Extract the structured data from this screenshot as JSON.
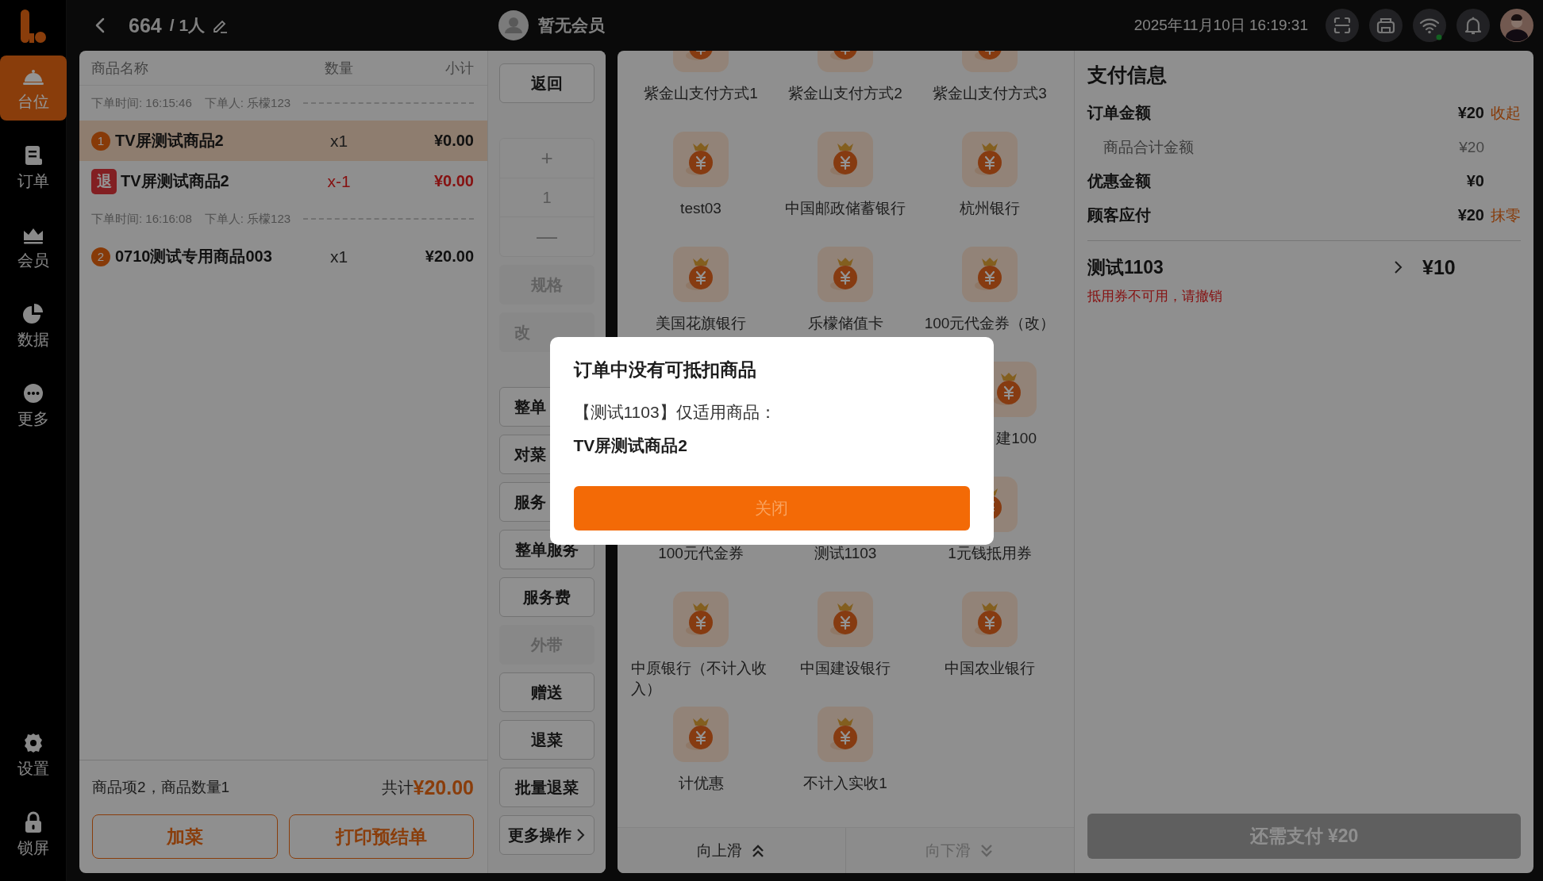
{
  "sidebar": {
    "items": [
      {
        "kind": "cloche",
        "label": "台位",
        "selected": true
      },
      {
        "kind": "document",
        "label": "订单",
        "selected": false
      },
      {
        "kind": "crown",
        "label": "会员",
        "selected": false
      },
      {
        "kind": "pie",
        "label": "数据",
        "selected": false
      },
      {
        "kind": "more",
        "label": "更多",
        "selected": false
      }
    ],
    "bottom_items": [
      {
        "kind": "gear",
        "label": "设置"
      },
      {
        "kind": "lock",
        "label": "锁屏"
      }
    ]
  },
  "top_bar": {
    "table": "664",
    "guests": "/ 1人",
    "member": "暂无会员",
    "datetime": "2025年11月10日 16:19:31"
  },
  "order_list": {
    "columns": [
      "商品名称",
      "数量",
      "小计"
    ],
    "groups": [
      {
        "time": "下单时间: 16:15:46",
        "orderer": "下单人: 乐檬123",
        "items": [
          {
            "kind": "numbered",
            "badge": "1",
            "name": "TV屏测试商品2",
            "qty": "x1",
            "subtotal": "¥0.00",
            "selected": true
          },
          {
            "kind": "returned",
            "badge": "退",
            "name": "TV屏测试商品2",
            "qty": "x-1",
            "subtotal": "¥0.00",
            "selected": false
          }
        ]
      },
      {
        "time": "下单时间: 16:16:08",
        "orderer": "下单人: 乐檬123",
        "items": [
          {
            "kind": "numbered",
            "badge": "2",
            "name": "0710测试专用商品003",
            "qty": "x1",
            "subtotal": "¥20.00",
            "selected": false
          }
        ]
      }
    ],
    "summary": "商品项2，商品数量1",
    "total_label": "共计",
    "total": "¥20.00",
    "buttons": [
      "加菜",
      "打印预结单"
    ]
  },
  "actions": [
    {
      "kind": "button",
      "label": "返回",
      "disabled": false,
      "cut": false
    },
    {
      "kind": "stepper",
      "plus": "+",
      "value": "1",
      "minus": "—",
      "disabled": true
    },
    {
      "kind": "button",
      "label": "规格",
      "disabled": true,
      "cut": false
    },
    {
      "kind": "button",
      "label": "改",
      "disabled": true,
      "cut": true
    },
    {
      "kind": "button",
      "label": "整单",
      "disabled": false,
      "cut": true
    },
    {
      "kind": "button",
      "label": "对菜",
      "disabled": false,
      "cut": true
    },
    {
      "kind": "button",
      "label": "服务",
      "disabled": false,
      "cut": true
    },
    {
      "kind": "button",
      "label": "整单服务",
      "disabled": false,
      "cut": false
    },
    {
      "kind": "button",
      "label": "服务费",
      "disabled": false,
      "cut": false
    },
    {
      "kind": "button",
      "label": "外带",
      "disabled": true,
      "cut": false
    },
    {
      "kind": "button",
      "label": "赠送",
      "disabled": false,
      "cut": false
    },
    {
      "kind": "button",
      "label": "退菜",
      "disabled": false,
      "cut": false
    },
    {
      "kind": "button",
      "label": "批量退菜",
      "disabled": false,
      "cut": false
    },
    {
      "kind": "menu",
      "label": "更多操作",
      "disabled": false,
      "cut": false
    }
  ],
  "payment_methods": {
    "rows": [
      [
        {
          "label": "紫金山支付方式1",
          "icon_shown": true
        },
        {
          "label": "紫金山支付方式2",
          "icon_shown": true
        },
        {
          "label": "紫金山支付方式3",
          "icon_shown": true
        }
      ],
      [
        {
          "label": "test03",
          "icon_shown": true
        },
        {
          "label": "中国邮政储蓄银行",
          "icon_shown": true
        },
        {
          "label": "杭州银行",
          "icon_shown": true
        }
      ],
      [
        {
          "label": "美国花旗银行",
          "icon_shown": true
        },
        {
          "label": "乐檬储值卡",
          "icon_shown": true
        },
        {
          "label": "100元代金券（改）",
          "icon_shown": true
        }
      ],
      [
        {},
        {},
        {
          "label": "建100",
          "icon_shown": true,
          "label_cut": true
        }
      ],
      [
        {
          "label": "100元代金券"
        },
        {
          "label": "测试1103"
        },
        {
          "label": "1元钱抵用券",
          "icon_shown": true
        }
      ],
      [
        {
          "label": "中原银行（不计入收入）",
          "icon_shown": true
        },
        {
          "label": "中国建设银行",
          "icon_shown": true
        },
        {
          "label": "中国农业银行",
          "icon_shown": true
        }
      ],
      [
        {
          "label": "计优惠",
          "icon_shown": true
        },
        {
          "label": "不计入实收1",
          "icon_shown": true
        }
      ]
    ],
    "scroll_up": {
      "label": "向上滑",
      "disabled": false
    },
    "scroll_down": {
      "label": "向下滑",
      "disabled": true
    }
  },
  "payment_info": {
    "title": "支付信息",
    "rows": [
      {
        "kind": "main",
        "label": "订单金额",
        "value": "¥20",
        "action": "收起"
      },
      {
        "kind": "sub",
        "label": "商品合计金额",
        "value": "¥20"
      },
      {
        "kind": "main",
        "label": "优惠金额",
        "value": "¥0"
      },
      {
        "kind": "main",
        "label": "顾客应付",
        "value": "¥20",
        "action": "抹零"
      }
    ],
    "coupon": {
      "name": "测试1103",
      "amount": "¥10",
      "warning": "抵用券不可用，请撤销"
    },
    "pay_button": {
      "label": "还需支付 ¥20",
      "disabled": true
    }
  },
  "dialog": {
    "title": "订单中没有可抵扣商品",
    "message": "【测试1103】仅适用商品：",
    "product": "TV屏测试商品2",
    "button": "关闭"
  }
}
